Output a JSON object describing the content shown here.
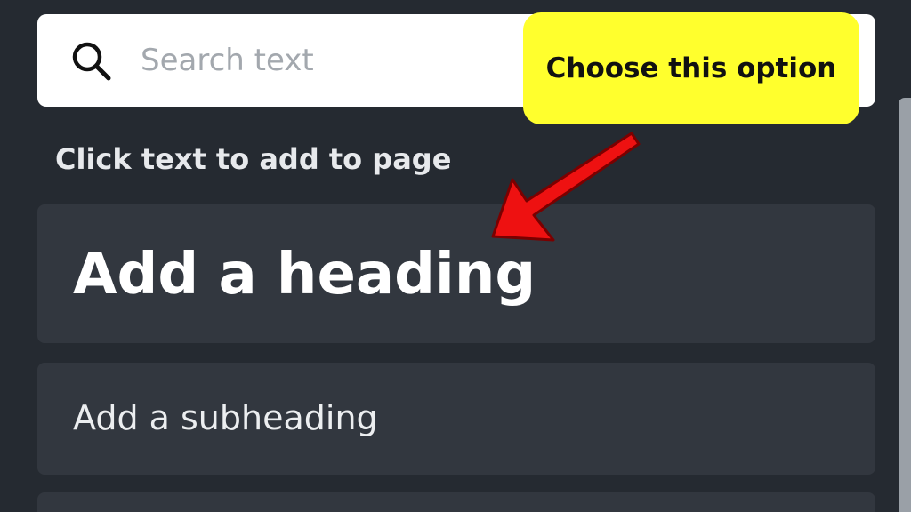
{
  "search": {
    "placeholder": "Search text",
    "value": "",
    "icon": "search-icon"
  },
  "section": {
    "label": "Click text to add to page"
  },
  "options": [
    {
      "label": "Add a heading"
    },
    {
      "label": "Add a subheading"
    }
  ],
  "annotation": {
    "callout_text": "Choose this option",
    "callout_color": "#ffff2d",
    "arrow_color": "#ee1111"
  },
  "colors": {
    "panel_bg": "#252a31",
    "option_bg": "#32373f"
  }
}
